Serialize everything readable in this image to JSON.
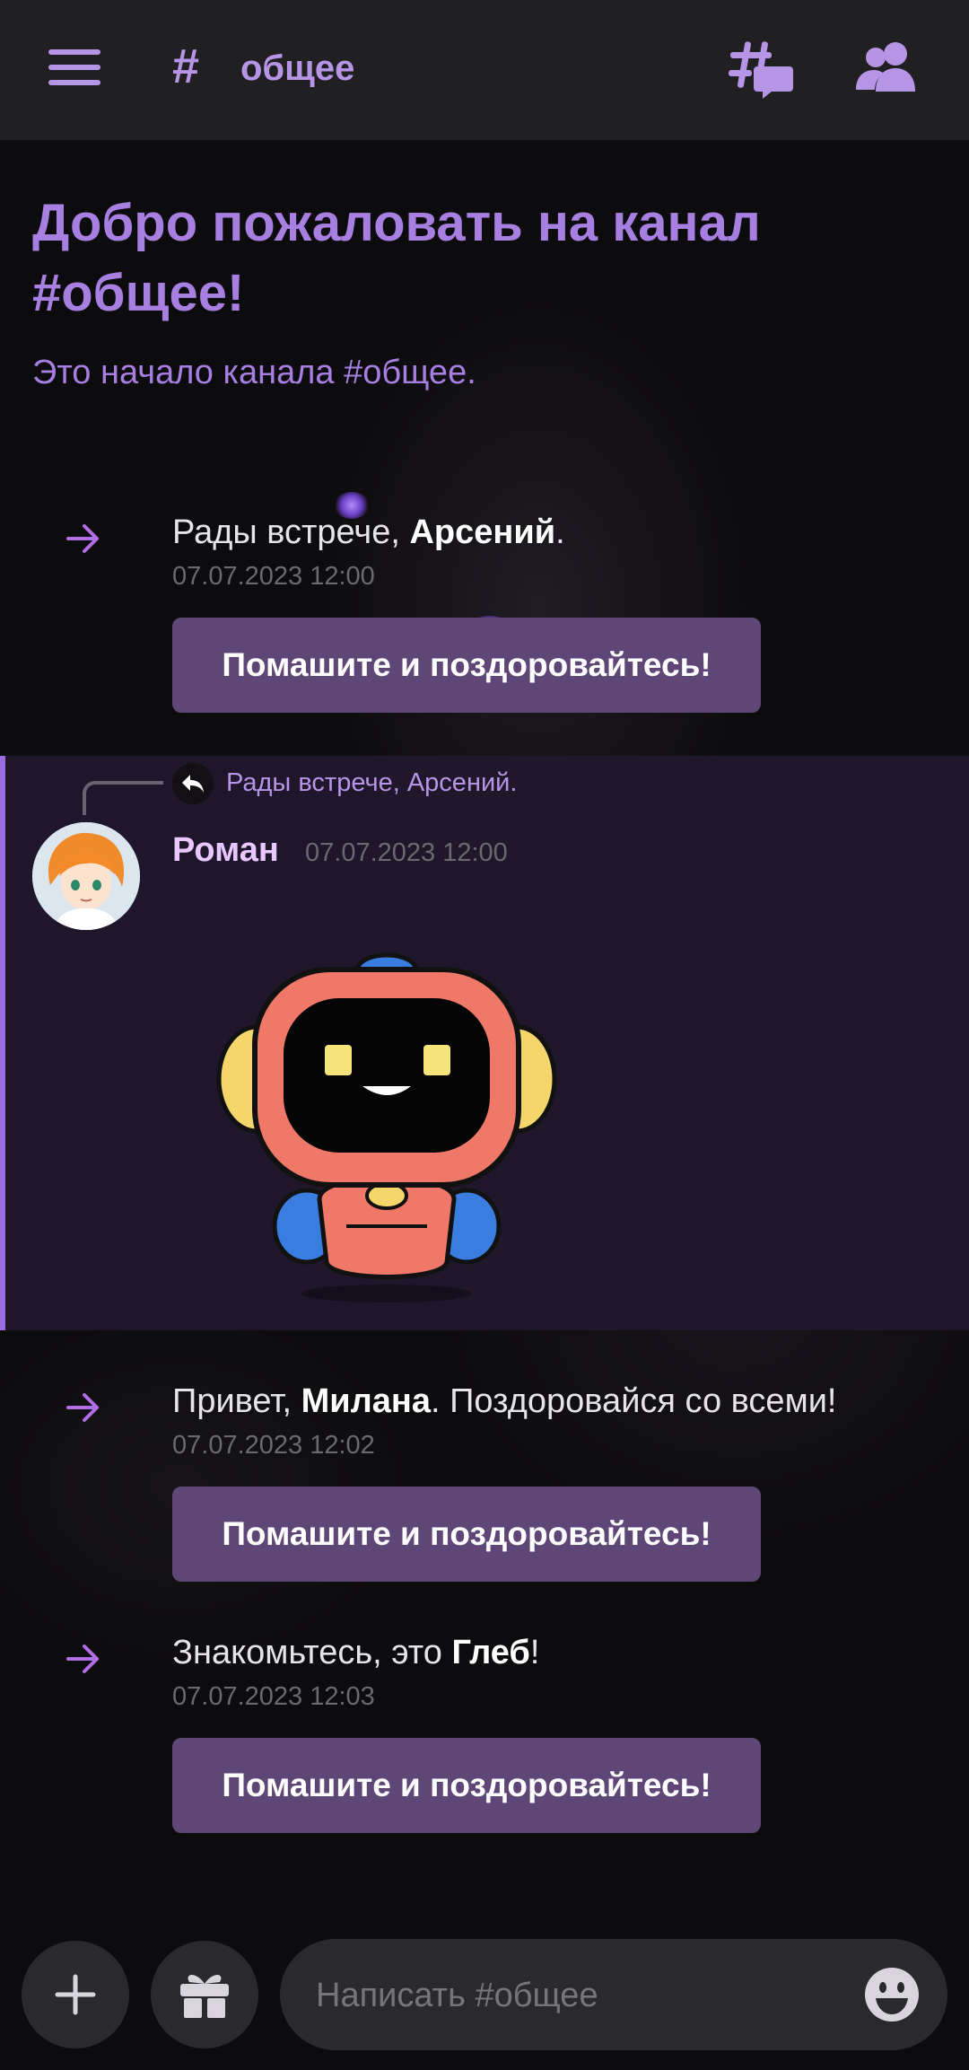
{
  "header": {
    "channel_name": "общее",
    "menu_icon": "hamburger-menu-icon",
    "channel_icon": "hash-icon",
    "threads_icon": "threads-icon",
    "members_icon": "members-icon"
  },
  "welcome": {
    "title": "Добро пожаловать на канал #общее!",
    "subtitle": "Это начало канала #общее."
  },
  "system_messages": [
    {
      "pre": "Рады встрече, ",
      "name": "Арсений",
      "post": ".",
      "time": "07.07.2023 12:00",
      "button": "Помашите и поздоровайтесь!"
    },
    {
      "pre": "Привет, ",
      "name": "Милана",
      "post": ". Поздоровайся со всеми!",
      "time": "07.07.2023 12:02",
      "button": "Помашите и поздоровайтесь!"
    },
    {
      "pre": "Знакомьтесь, это ",
      "name": "Глеб",
      "post": "!",
      "time": "07.07.2023 12:03",
      "button": "Помашите и поздоровайтесь!"
    }
  ],
  "reply_message": {
    "reply_to": "Рады встрече, Арсений.",
    "author": "Роман",
    "time": "07.07.2023 12:00",
    "sticker": "robot-wave-sticker"
  },
  "composer": {
    "placeholder": "Написать #общее",
    "add_icon": "plus-icon",
    "gift_icon": "gift-icon",
    "emoji_icon": "emoji-icon"
  },
  "colors": {
    "accent": "#b795e6",
    "button": "#5e4776",
    "highlight_border": "#9b6be0",
    "author": "#e9c7ff"
  }
}
